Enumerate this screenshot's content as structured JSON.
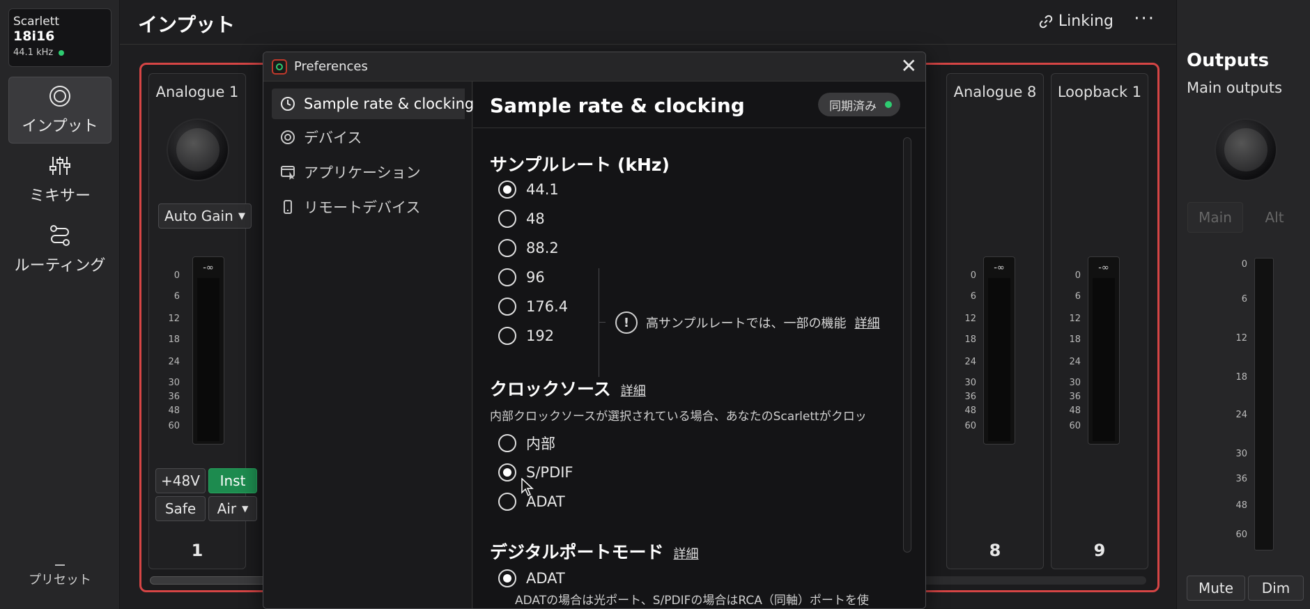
{
  "device": {
    "brand": "Scarlett",
    "model": "18i16",
    "sample_rate": "44.1 kHz"
  },
  "nav": {
    "items": [
      {
        "label": "インプット"
      },
      {
        "label": "ミキサー"
      },
      {
        "label": "ルーティング"
      }
    ],
    "preset": {
      "label": "プリセット"
    }
  },
  "header": {
    "title": "インプット",
    "linking": "Linking",
    "more": "···"
  },
  "channels": {
    "ch1": {
      "name": "Analogue 1",
      "number": "1",
      "gain_mode": "Auto Gain",
      "peak": "-∞",
      "phantom": "+48V",
      "inst": "Inst",
      "safe": "Safe",
      "air": "Air"
    },
    "ch8": {
      "name": "Analogue 8",
      "number": "8",
      "peak": "-∞"
    },
    "ch9": {
      "name": "Loopback 1",
      "number": "9",
      "peak": "-∞"
    },
    "meter_scale": [
      "0",
      "6",
      "12",
      "18",
      "24",
      "30",
      "36",
      "48",
      "60"
    ]
  },
  "outputs": {
    "title": "Outputs",
    "subtitle": "Main outputs",
    "main": "Main",
    "alt": "Alt",
    "mute": "Mute",
    "dim": "Dim",
    "scale": [
      "0",
      "6",
      "12",
      "18",
      "24",
      "30",
      "36",
      "48",
      "60"
    ]
  },
  "preferences": {
    "window_title": "Preferences",
    "close": "✕",
    "sidebar": [
      {
        "label": "Sample rate & clocking"
      },
      {
        "label": "デバイス"
      },
      {
        "label": "アプリケーション"
      },
      {
        "label": "リモートデバイス"
      }
    ],
    "content_title": "Sample rate & clocking",
    "sync_status": "同期済み",
    "sample_rate": {
      "heading": "サンプルレート (kHz)",
      "options": [
        "44.1",
        "48",
        "88.2",
        "96",
        "176.4",
        "192"
      ],
      "selected": "44.1",
      "info": "高サンプルレートでは、一部の機能",
      "info_link": "詳細"
    },
    "clock_source": {
      "heading": "クロックソース",
      "link": "詳細",
      "description": "内部クロックソースが選択されている場合、あなたのScarlettがクロッ",
      "options": [
        "内部",
        "S/PDIF",
        "ADAT"
      ],
      "selected": "S/PDIF"
    },
    "digital_port_mode": {
      "heading": "デジタルポートモード",
      "link": "詳細",
      "options": [
        "ADAT"
      ],
      "selected": "ADAT",
      "description": "ADATの場合は光ポート、S/PDIFの場合はRCA（同軸）ポートを使"
    }
  }
}
